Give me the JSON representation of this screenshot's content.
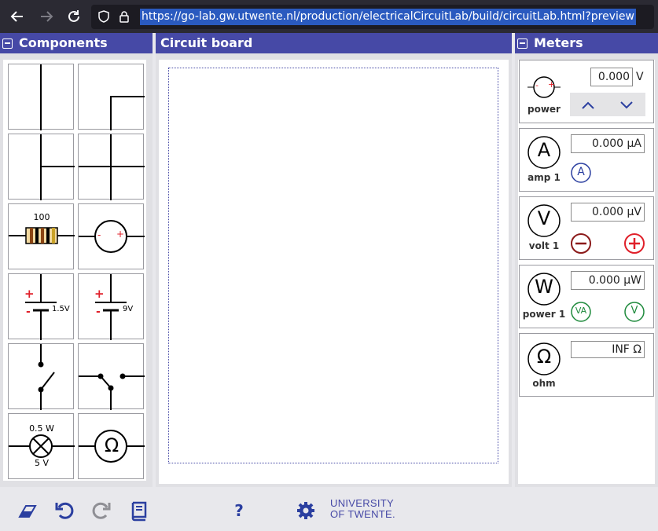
{
  "browser": {
    "url": "https://go-lab.gw.utwente.nl/production/electricalCircuitLab/build/circuitLab.html?preview",
    "back_icon": "arrow-left-icon",
    "forward_icon": "arrow-right-icon",
    "reload_icon": "reload-icon"
  },
  "panels": {
    "components_title": "Components",
    "board_title": "Circuit board",
    "meters_title": "Meters"
  },
  "components": {
    "resistor_value": "100",
    "battery1_value": "1.5V",
    "battery2_value": "9V",
    "lamp_power": "0.5 W",
    "lamp_voltage": "5 V",
    "battery_plus": "+",
    "battery_minus": "-",
    "source_minus": "-",
    "source_plus": "+",
    "ohm_symbol": "Ω"
  },
  "meters": {
    "power": {
      "label": "power",
      "value": "0.000",
      "unit": "V",
      "symbol_minus": "-",
      "symbol_plus": "+"
    },
    "amp1": {
      "label": "amp 1",
      "value": "0.000 μA",
      "symbol": "A",
      "probe": "A"
    },
    "volt1": {
      "label": "volt 1",
      "value": "0.000 μV",
      "symbol": "V"
    },
    "power1": {
      "label": "power 1",
      "value": "0.000 μW",
      "symbol": "W",
      "probe_va": "VA",
      "probe_v": "V"
    },
    "ohm": {
      "label": "ohm",
      "value": "INF Ω",
      "symbol": "Ω"
    }
  },
  "toolbar": {
    "help_label": "?",
    "logo_line1": "UNIVERSITY",
    "logo_line2": "OF TWENTE."
  },
  "colors": {
    "accent": "#4649a6",
    "red": "#e0202a",
    "dark_red": "#8b1a1a",
    "green": "#1e8a3c"
  }
}
